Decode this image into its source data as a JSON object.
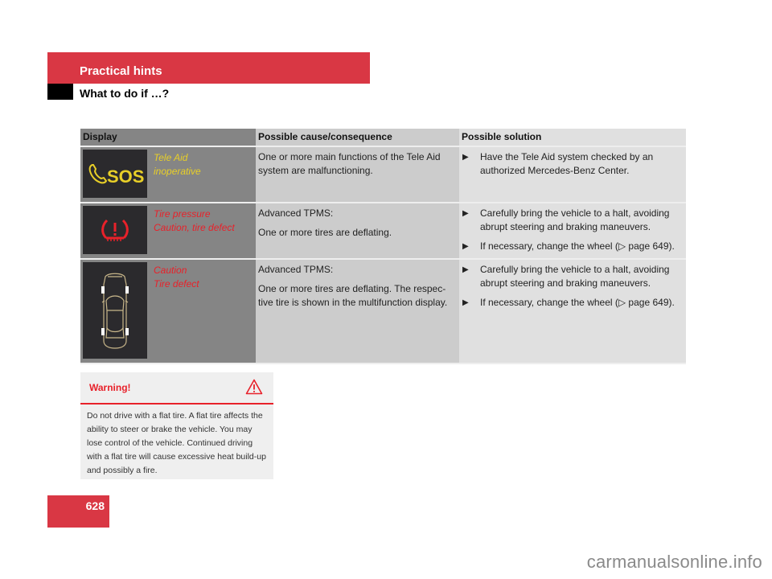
{
  "header": {
    "section_title": "Practical hints",
    "subtitle": "What to do if …?"
  },
  "table": {
    "columns": [
      "Display",
      "Possible cause/consequence",
      "Possible solution"
    ],
    "rows": [
      {
        "icon": "sos-phone-icon",
        "display_color": "#e8cf28",
        "display_lines": [
          "Tele Aid",
          "inoperative"
        ],
        "cause": [
          "One or more main functions of the Tele Aid system are malfunctioning."
        ],
        "solutions": [
          "Have the Tele Aid system checked by an authorized Mercedes-Benz Center."
        ]
      },
      {
        "icon": "tire-pressure-warning-icon",
        "display_color": "#e8212a",
        "display_lines": [
          "Tire pressure",
          "Caution, tire defect"
        ],
        "cause": [
          "Advanced TPMS:",
          "One or more tires are deflating."
        ],
        "solutions": [
          "Carefully bring the vehicle to a halt, avoiding abrupt steering and braking maneuvers.",
          "If necessary, change the wheel (▷ page 649)."
        ]
      },
      {
        "icon": "car-top-view-tires-icon",
        "display_color": "#e8212a",
        "display_lines": [
          "Caution",
          "Tire defect"
        ],
        "cause": [
          "Advanced TPMS:",
          "One or more tires are deflating. The respec-tive tire is shown in the multifunction display."
        ],
        "solutions": [
          "Carefully bring the vehicle to a halt, avoiding abrupt steering and braking maneuvers.",
          "If necessary, change the wheel (▷ page 649)."
        ]
      }
    ]
  },
  "warning": {
    "title": "Warning!",
    "icon": "warning-triangle-icon",
    "body": "Do not drive with a flat tire. A flat tire affects the ability to steer or brake the vehicle. You may lose control of the vehicle. Continued driving with a flat tire will cause excessive heat build-up and possibly a fire."
  },
  "page_number": "628",
  "watermark": "carmanualsonline.info",
  "colors": {
    "brand_red": "#d93744",
    "warning_red": "#e8212a",
    "indicator_yellow": "#e8cf28"
  }
}
